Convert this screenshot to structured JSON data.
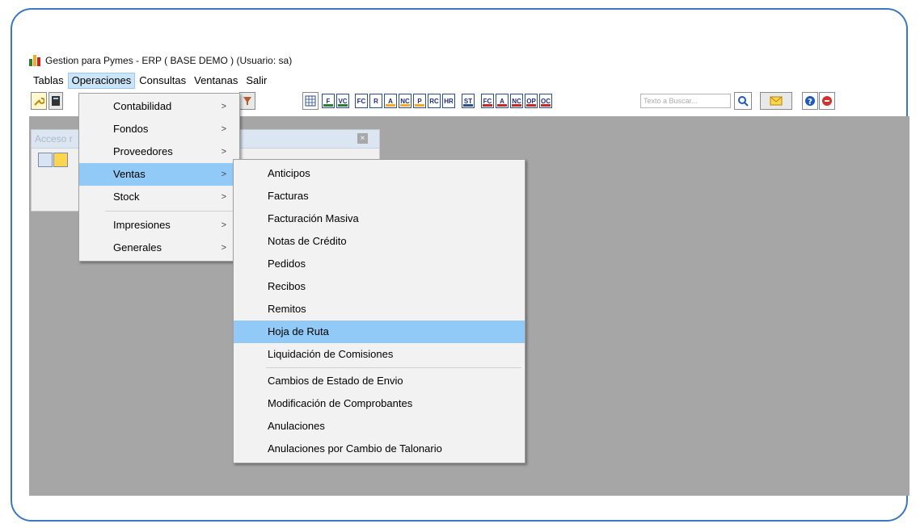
{
  "window": {
    "title": "Gestion para Pymes - ERP ( BASE DEMO ) (Usuario: sa)"
  },
  "menubar": [
    {
      "label": "Tablas"
    },
    {
      "label": "Operaciones",
      "active": true
    },
    {
      "label": "Consultas"
    },
    {
      "label": "Ventanas"
    },
    {
      "label": "Salir"
    }
  ],
  "toolbar": {
    "buttons": [
      {
        "label": "F"
      },
      {
        "label": "VC"
      },
      {
        "label": "FC"
      },
      {
        "label": "R"
      },
      {
        "label": "A"
      },
      {
        "label": "NC"
      },
      {
        "label": "P"
      },
      {
        "label": "RC"
      },
      {
        "label": "HR"
      },
      {
        "label": "ST"
      },
      {
        "label": "FC"
      },
      {
        "label": "A"
      },
      {
        "label": "NC"
      },
      {
        "label": "OP"
      },
      {
        "label": "OC"
      }
    ],
    "search_placeholder": "Texto a Buscar..."
  },
  "panel": {
    "title": "Acceso r"
  },
  "operaciones_menu": {
    "groups": [
      [
        {
          "label": "Contabilidad",
          "submenu": true
        },
        {
          "label": "Fondos",
          "submenu": true
        },
        {
          "label": "Proveedores",
          "submenu": true
        },
        {
          "label": "Ventas",
          "submenu": true,
          "highlight": true
        },
        {
          "label": "Stock",
          "submenu": true
        }
      ],
      [
        {
          "label": "Impresiones",
          "submenu": true
        },
        {
          "label": "Generales",
          "submenu": true
        }
      ]
    ]
  },
  "ventas_menu": {
    "groups": [
      [
        {
          "label": "Anticipos"
        },
        {
          "label": "Facturas"
        },
        {
          "label": "Facturación Masiva"
        },
        {
          "label": "Notas de Crédito"
        },
        {
          "label": "Pedidos"
        },
        {
          "label": "Recibos"
        },
        {
          "label": "Remitos"
        },
        {
          "label": "Hoja de Ruta",
          "highlight": true
        },
        {
          "label": "Liquidación de Comisiones"
        }
      ],
      [
        {
          "label": "Cambios de Estado de Envio"
        },
        {
          "label": "Modificación de Comprobantes"
        },
        {
          "label": "Anulaciones"
        },
        {
          "label": "Anulaciones por Cambio de Talonario"
        }
      ]
    ]
  },
  "colors": {
    "frame": "#3b78c2",
    "workspace": "#a6a6a6",
    "highlight": "#91c9f7",
    "menu_bg": "#f2f2f2"
  }
}
